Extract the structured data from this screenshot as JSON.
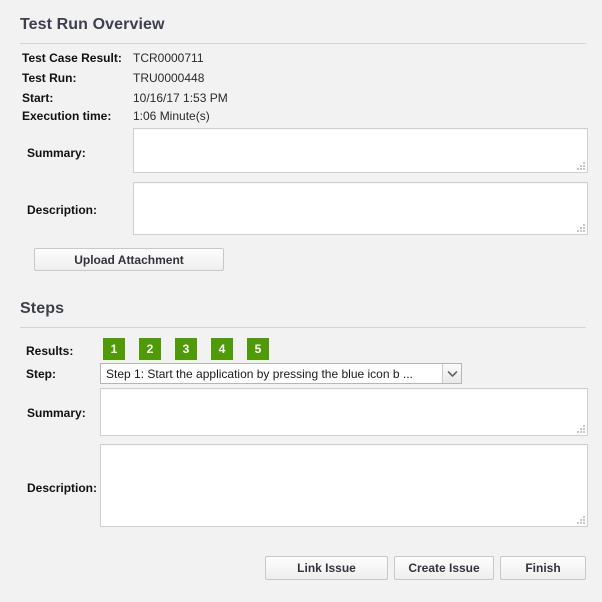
{
  "overview": {
    "title": "Test Run Overview",
    "fields": [
      {
        "label": "Test Case Result:",
        "value": "TCR0000711"
      },
      {
        "label": "Test Run:",
        "value": "TRU0000448"
      },
      {
        "label": "Start:",
        "value": "10/16/17 1:53 PM"
      },
      {
        "label": "Execution time:",
        "value": "1:06 Minute(s)"
      }
    ],
    "summary_label": "Summary:",
    "summary_value": "",
    "description_label": "Description:",
    "description_value": "",
    "upload_button": "Upload Attachment"
  },
  "steps": {
    "title": "Steps",
    "results_label": "Results:",
    "results": [
      {
        "number": "1",
        "color": "#4f9a07"
      },
      {
        "number": "2",
        "color": "#4f9a07"
      },
      {
        "number": "3",
        "color": "#4f9a07"
      },
      {
        "number": "4",
        "color": "#4f9a07"
      },
      {
        "number": "5",
        "color": "#4f9a07"
      }
    ],
    "step_label": "Step:",
    "step_selected": "Step 1: Start the application by pressing the blue icon b ...",
    "summary_label": "Summary:",
    "summary_value": "",
    "description_label": "Description:",
    "description_value": ""
  },
  "actions": {
    "link_issue": "Link Issue",
    "create_issue": "Create Issue",
    "finish": "Finish"
  },
  "icons": {
    "chevron_down": "chevron-down-icon",
    "resize_grip": "resize-grip-icon"
  }
}
